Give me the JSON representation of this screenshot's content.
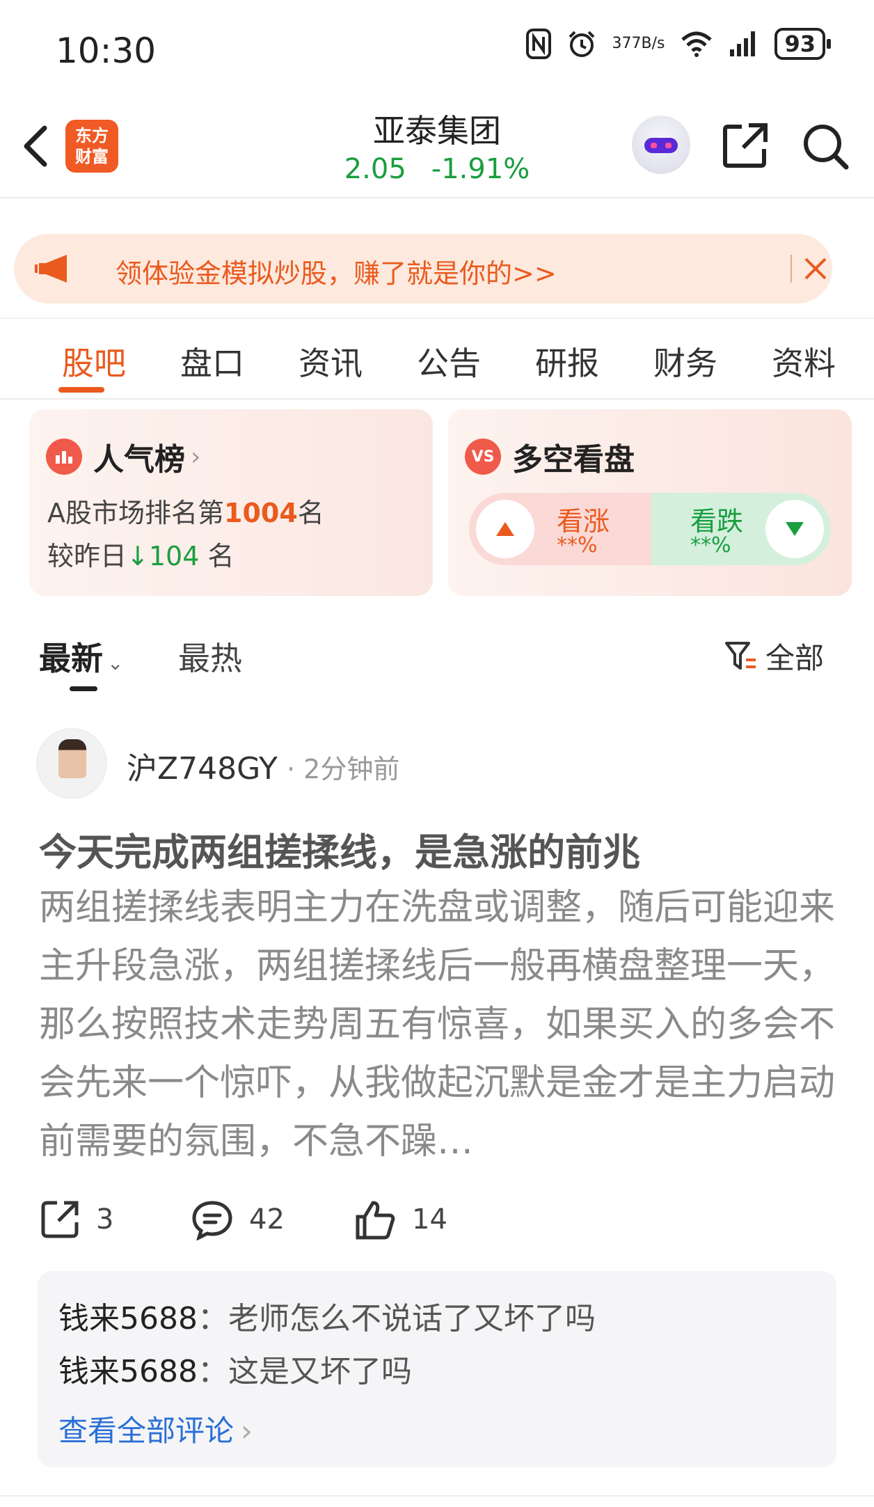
{
  "status_bar": {
    "time": "10:30",
    "net_speed_value": "377",
    "net_speed_unit": "B/s",
    "battery": "93"
  },
  "header": {
    "brand_line1": "东方",
    "brand_line2": "财富",
    "stock_name": "亚泰集团",
    "price": "2.05",
    "change_pct": "-1.91%"
  },
  "promo": {
    "text": "领体验金模拟炒股，赚了就是你的>>"
  },
  "tabs": [
    {
      "label": "股吧",
      "active": true
    },
    {
      "label": "盘口"
    },
    {
      "label": "资讯"
    },
    {
      "label": "公告"
    },
    {
      "label": "研报"
    },
    {
      "label": "财务"
    },
    {
      "label": "资料"
    }
  ],
  "rank_card": {
    "title": "人气榜",
    "line1_prefix": "A股市场排名第",
    "rank": "1004",
    "line1_suffix": "名",
    "line2_prefix": "较昨日",
    "change": "104",
    "line2_suffix": "名"
  },
  "vote_card": {
    "icon_text": "VS",
    "title": "多空看盘",
    "up_label": "看涨",
    "up_pct": "**%",
    "down_label": "看跌",
    "down_pct": "**%"
  },
  "filters": {
    "latest": "最新",
    "hot": "最热",
    "all": "全部"
  },
  "post": {
    "author": "沪Z748GY",
    "time": "· 2分钟前",
    "title": "今天完成两组搓揉线，是急涨的前兆",
    "body": "两组搓揉线表明主力在洗盘或调整，随后可能迎来主升段急涨，两组搓揉线后一般再横盘整理一天，那么按照技术走势周五有惊喜，如果买入的多会不会先来一个惊吓，从我做起沉默是金才是主力启动前需要的氛围，不急不躁…",
    "shares": "3",
    "comments": "42",
    "likes": "14"
  },
  "comments": [
    {
      "user": "钱来5688",
      "text": "：老师怎么不说话了又坏了吗"
    },
    {
      "user": "钱来5688",
      "text": "：这是又坏了吗"
    }
  ],
  "view_all_comments": "查看全部评论",
  "colors": {
    "accent": "#ea5a1e",
    "down_green": "#1a9e3f",
    "promo_bg": "#fde9de",
    "link_blue": "#2a6fd6"
  }
}
